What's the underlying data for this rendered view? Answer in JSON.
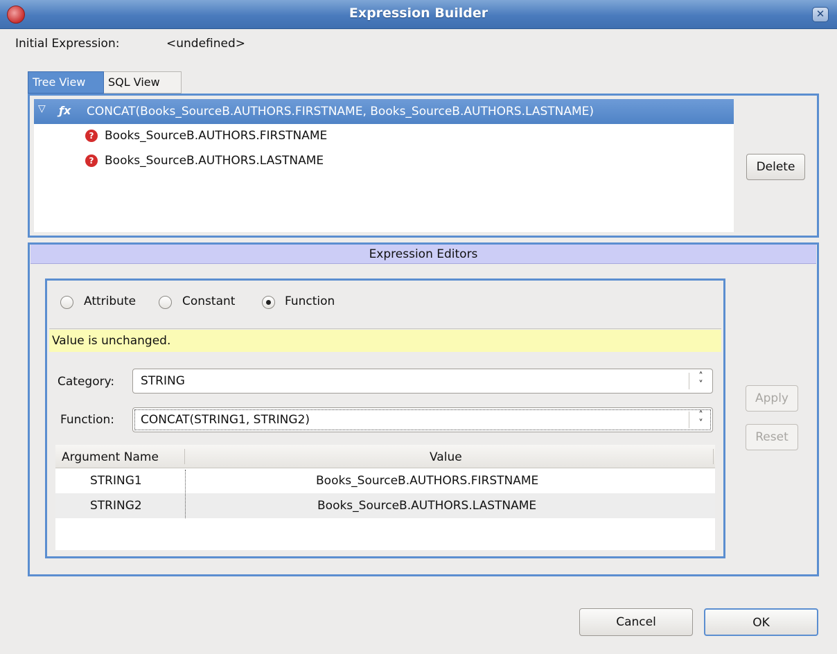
{
  "window": {
    "title": "Expression Builder"
  },
  "initial_expression": {
    "label": "Initial Expression:",
    "value": "<undefined>"
  },
  "tabs": [
    {
      "label": "Tree View",
      "active": true
    },
    {
      "label": "SQL View",
      "active": false
    }
  ],
  "tree": {
    "root": {
      "icon": "function-icon",
      "label": "CONCAT(Books_SourceB.AUTHORS.FIRSTNAME, Books_SourceB.AUTHORS.LASTNAME)",
      "expanded": true
    },
    "children": [
      {
        "icon": "question-icon",
        "label": "Books_SourceB.AUTHORS.FIRSTNAME"
      },
      {
        "icon": "question-icon",
        "label": "Books_SourceB.AUTHORS.LASTNAME"
      }
    ]
  },
  "buttons": {
    "delete": "Delete",
    "apply": "Apply",
    "reset": "Reset",
    "cancel": "Cancel",
    "ok": "OK"
  },
  "editors": {
    "header": "Expression Editors",
    "radio_options": [
      {
        "label": "Attribute",
        "selected": false
      },
      {
        "label": "Constant",
        "selected": false
      },
      {
        "label": "Function",
        "selected": true
      }
    ],
    "status": "Value is unchanged.",
    "category": {
      "label": "Category:",
      "value": "STRING"
    },
    "function": {
      "label": "Function:",
      "value": "CONCAT(STRING1, STRING2)"
    },
    "table": {
      "columns": [
        "Argument Name",
        "Value"
      ],
      "rows": [
        {
          "name": "STRING1",
          "value": "Books_SourceB.AUTHORS.FIRSTNAME"
        },
        {
          "name": "STRING2",
          "value": "Books_SourceB.AUTHORS.LASTNAME"
        }
      ]
    }
  },
  "colors": {
    "accent": "#5b8ed0",
    "editors_header": "#cccdf6",
    "status_bg": "#fbfbb5",
    "error_icon": "#d42c2c"
  }
}
